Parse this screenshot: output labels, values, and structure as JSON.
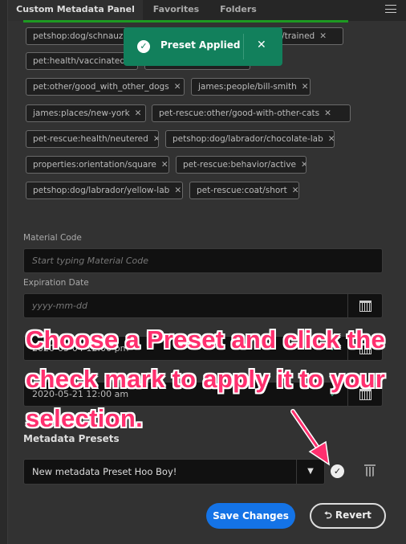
{
  "tabs": [
    {
      "label": "Custom Metadata Panel",
      "active": true
    },
    {
      "label": "Favorites"
    },
    {
      "label": "Folders"
    }
  ],
  "tags": [
    {
      "label": "petshop:dog/schnauzer"
    },
    {
      "label": ""
    },
    {
      "label": "behavior/trained"
    },
    {
      "label": "pet:health/vaccinated"
    },
    {
      "label": ""
    },
    {
      "label": "pet:other/good_with_other_dogs"
    },
    {
      "label": "james:people/bill-smith"
    },
    {
      "label": "james:places/new-york"
    },
    {
      "label": "pet-rescue:other/good-with-other-cats"
    },
    {
      "label": "pet-rescue:health/neutered"
    },
    {
      "label": "petshop:dog/labrador/chocolate-lab"
    },
    {
      "label": "properties:orientation/square"
    },
    {
      "label": "pet-rescue:behavior/active"
    },
    {
      "label": "petshop:dog/labrador/yellow-lab"
    },
    {
      "label": "pet-rescue:coat/short"
    }
  ],
  "toast": {
    "message": "Preset Applied",
    "color": "#12805c"
  },
  "form": {
    "material_code": {
      "label": "Material Code",
      "placeholder": "Start typing Material Code"
    },
    "expiration_date": {
      "label": "Expiration Date",
      "placeholder": "yyyy-mm-dd"
    },
    "date2": {
      "value": "2020-05-04 12:00 pm"
    },
    "date3": {
      "value": "2020-05-21 12:00 am"
    }
  },
  "presets": {
    "label": "Metadata Presets",
    "selected": "New metadata Preset Hoo Boy!"
  },
  "buttons": {
    "save": "Save Changes",
    "revert": "Revert"
  },
  "annotation": {
    "text": "Choose a Preset and click the check mark to apply it to your selection.",
    "color": "#ff2f6e"
  },
  "colors": {
    "accent": "#1473e6",
    "progress": "#1d9a22"
  }
}
